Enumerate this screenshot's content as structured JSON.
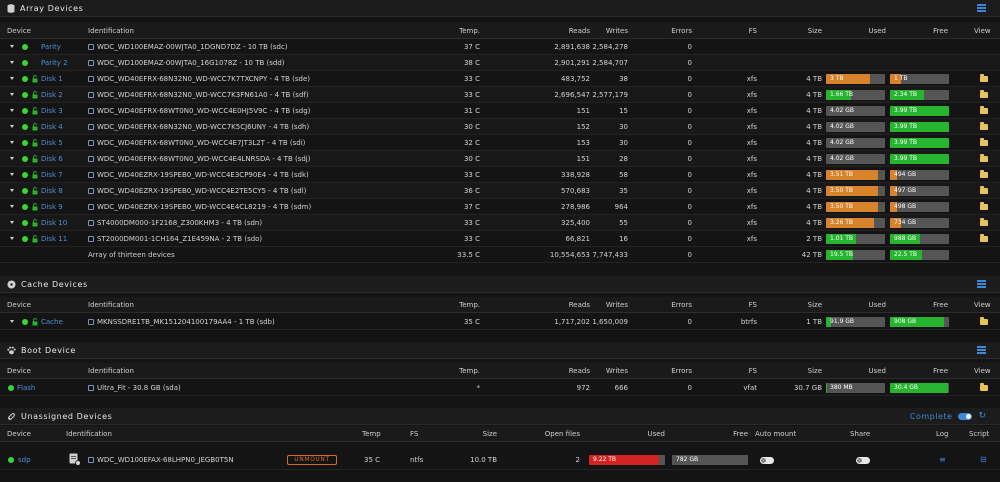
{
  "array": {
    "title": "Array Devices",
    "headers": {
      "device": "Device",
      "identification": "Identification",
      "temp": "Temp.",
      "reads": "Reads",
      "writes": "Writes",
      "errors": "Errors",
      "fs": "FS",
      "size": "Size",
      "used": "Used",
      "free": "Free",
      "view": "View"
    },
    "rows": [
      {
        "name": "Parity",
        "lock": false,
        "id": "WDC_WD100EMAZ-00WJTA0_1DGND7DZ - 10 TB (sdc)",
        "temp": "37 C",
        "reads": "2,891,638",
        "writes": "2,584,278",
        "errors": "0",
        "fs": "",
        "size": "",
        "used": null,
        "free": null,
        "view": false
      },
      {
        "name": "Parity 2",
        "lock": false,
        "id": "WDC_WD100EMAZ-00WJTA0_16G1078Z - 10 TB (sdd)",
        "temp": "38 C",
        "reads": "2,901,291",
        "writes": "2,584,707",
        "errors": "0",
        "fs": "",
        "size": "",
        "used": null,
        "free": null,
        "view": false
      },
      {
        "name": "Disk 1",
        "lock": true,
        "id": "WDC_WD40EFRX-68N32N0_WD-WCC7K7TXCNPY - 4 TB (sde)",
        "temp": "33 C",
        "reads": "483,752",
        "writes": "38",
        "errors": "0",
        "fs": "xfs",
        "size": "4 TB",
        "used": {
          "label": "3 TB",
          "pct": 75,
          "color": "orange"
        },
        "free": {
          "label": "1 TB",
          "pct": 18,
          "color": "orange"
        },
        "view": true
      },
      {
        "name": "Disk 2",
        "lock": true,
        "id": "WDC_WD40EFRX-68N32N0_WD-WCC7K3FN61A0 - 4 TB (sdf)",
        "temp": "33 C",
        "reads": "2,696,547",
        "writes": "2,577,179",
        "errors": "0",
        "fs": "xfs",
        "size": "4 TB",
        "used": {
          "label": "1.66 TB",
          "pct": 42,
          "color": "green"
        },
        "free": {
          "label": "2.34 TB",
          "pct": 58,
          "color": "green"
        },
        "view": true
      },
      {
        "name": "Disk 3",
        "lock": true,
        "id": "WDC_WD40EFRX-68WT0N0_WD-WCC4E0HJ5V9C - 4 TB (sdg)",
        "temp": "31 C",
        "reads": "151",
        "writes": "15",
        "errors": "0",
        "fs": "xfs",
        "size": "4 TB",
        "used": {
          "label": "4.02 GB",
          "pct": 0,
          "color": "green"
        },
        "free": {
          "label": "3.99 TB",
          "pct": 100,
          "color": "green"
        },
        "view": true
      },
      {
        "name": "Disk 4",
        "lock": true,
        "id": "WDC_WD40EFRX-68N32N0_WD-WCC7K5CJ6UNY - 4 TB (sdh)",
        "temp": "30 C",
        "reads": "152",
        "writes": "30",
        "errors": "0",
        "fs": "xfs",
        "size": "4 TB",
        "used": {
          "label": "4.02 GB",
          "pct": 0,
          "color": "green"
        },
        "free": {
          "label": "3.99 TB",
          "pct": 100,
          "color": "green"
        },
        "view": true
      },
      {
        "name": "Disk 5",
        "lock": true,
        "id": "WDC_WD40EFRX-68WT0N0_WD-WCC4E7JT3L2T - 4 TB (sdi)",
        "temp": "32 C",
        "reads": "153",
        "writes": "30",
        "errors": "0",
        "fs": "xfs",
        "size": "4 TB",
        "used": {
          "label": "4.02 GB",
          "pct": 0,
          "color": "green"
        },
        "free": {
          "label": "3.99 TB",
          "pct": 100,
          "color": "green"
        },
        "view": true
      },
      {
        "name": "Disk 6",
        "lock": true,
        "id": "WDC_WD40EFRX-68WT0N0_WD-WCC4E4LNRSDA - 4 TB (sdj)",
        "temp": "30 C",
        "reads": "151",
        "writes": "28",
        "errors": "0",
        "fs": "xfs",
        "size": "4 TB",
        "used": {
          "label": "4.02 GB",
          "pct": 0,
          "color": "green"
        },
        "free": {
          "label": "3.99 TB",
          "pct": 100,
          "color": "green"
        },
        "view": true
      },
      {
        "name": "Disk 7",
        "lock": true,
        "id": "WDC_WD40EZRX-19SPEB0_WD-WCC4E3CP90E4 - 4 TB (sdk)",
        "temp": "33 C",
        "reads": "338,928",
        "writes": "58",
        "errors": "0",
        "fs": "xfs",
        "size": "4 TB",
        "used": {
          "label": "3.51 TB",
          "pct": 88,
          "color": "orange"
        },
        "free": {
          "label": "494 GB",
          "pct": 12,
          "color": "orange"
        },
        "view": true
      },
      {
        "name": "Disk 8",
        "lock": true,
        "id": "WDC_WD40EZRX-19SPEB0_WD-WCC4E2TE5CY5 - 4 TB (sdl)",
        "temp": "36 C",
        "reads": "570,683",
        "writes": "35",
        "errors": "0",
        "fs": "xfs",
        "size": "4 TB",
        "used": {
          "label": "3.50 TB",
          "pct": 88,
          "color": "orange"
        },
        "free": {
          "label": "497 GB",
          "pct": 12,
          "color": "orange"
        },
        "view": true
      },
      {
        "name": "Disk 9",
        "lock": true,
        "id": "WDC_WD40EZRX-19SPEB0_WD-WCC4E4CL8219 - 4 TB (sdm)",
        "temp": "37 C",
        "reads": "278,986",
        "writes": "964",
        "errors": "0",
        "fs": "xfs",
        "size": "4 TB",
        "used": {
          "label": "3.50 TB",
          "pct": 88,
          "color": "orange"
        },
        "free": {
          "label": "498 GB",
          "pct": 12,
          "color": "orange"
        },
        "view": true
      },
      {
        "name": "Disk 10",
        "lock": true,
        "id": "ST4000DM000-1F2168_Z300KHM3 - 4 TB (sdn)",
        "temp": "33 C",
        "reads": "325,400",
        "writes": "55",
        "errors": "0",
        "fs": "xfs",
        "size": "4 TB",
        "used": {
          "label": "3.26 TB",
          "pct": 82,
          "color": "orange"
        },
        "free": {
          "label": "734 GB",
          "pct": 18,
          "color": "orange"
        },
        "view": true
      },
      {
        "name": "Disk 11",
        "lock": true,
        "id": "ST2000DM001-1CH164_Z1E459NA - 2 TB (sdo)",
        "temp": "33 C",
        "reads": "66,821",
        "writes": "16",
        "errors": "0",
        "fs": "xfs",
        "size": "2 TB",
        "used": {
          "label": "1.01 TB",
          "pct": 50,
          "color": "green"
        },
        "free": {
          "label": "988 GB",
          "pct": 50,
          "color": "green"
        },
        "view": true
      }
    ],
    "summary": {
      "label": "Array of thirteen devices",
      "temp": "33.5 C",
      "reads": "10,554,653",
      "writes": "7,747,433",
      "errors": "0",
      "size": "42 TB",
      "used": {
        "label": "19.5 TB",
        "pct": 46,
        "color": "green"
      },
      "free": {
        "label": "22.5 TB",
        "pct": 54,
        "color": "green"
      }
    }
  },
  "cache": {
    "title": "Cache Devices",
    "headers": {
      "device": "Device",
      "identification": "Identification",
      "temp": "Temp.",
      "reads": "Reads",
      "writes": "Writes",
      "errors": "Errors",
      "fs": "FS",
      "size": "Size",
      "used": "Used",
      "free": "Free",
      "view": "View"
    },
    "rows": [
      {
        "name": "Cache",
        "lock": true,
        "id": "MKNSSDRE1TB_MK151204100179AA4 - 1 TB (sdb)",
        "temp": "35 C",
        "reads": "1,717,202",
        "writes": "1,650,009",
        "errors": "0",
        "fs": "btrfs",
        "size": "1 TB",
        "used": {
          "label": "91.9 GB",
          "pct": 9,
          "color": "green"
        },
        "free": {
          "label": "908 GB",
          "pct": 91,
          "color": "green"
        },
        "view": true
      }
    ]
  },
  "boot": {
    "title": "Boot Device",
    "headers": {
      "device": "Device",
      "identification": "Identification",
      "temp": "Temp.",
      "reads": "Reads",
      "writes": "Writes",
      "errors": "Errors",
      "fs": "FS",
      "size": "Size",
      "used": "Used",
      "free": "Free",
      "view": "View"
    },
    "rows": [
      {
        "name": "Flash",
        "id": "Ultra_Fit - 30.8 GB (sda)",
        "temp": "*",
        "reads": "972",
        "writes": "666",
        "errors": "0",
        "fs": "vfat",
        "size": "30.7 GB",
        "used": {
          "label": "380 MB",
          "pct": 1,
          "color": "green"
        },
        "free": {
          "label": "30.4 GB",
          "pct": 99,
          "color": "green"
        },
        "view": true
      }
    ]
  },
  "unassigned": {
    "title": "Unassigned Devices",
    "status": "Complete",
    "headers": {
      "device": "Device",
      "identification": "Identification",
      "temp": "Temp",
      "fs": "FS",
      "size": "Size",
      "open_files": "Open files",
      "used": "Used",
      "free": "Free",
      "auto_mount": "Auto mount",
      "share": "Share",
      "log": "Log",
      "script": "Script"
    },
    "row": {
      "name": "sdp",
      "id": "WDC_WD100EFAX-68LHPN0_JEGB0T5N",
      "button": "UNMOUNT",
      "temp": "35 C",
      "fs": "ntfs",
      "size": "10.0 TB",
      "open_files": "2",
      "used": {
        "label": "9.22 TB",
        "pct": 92,
        "color": "red"
      },
      "free": {
        "label": "782 GB",
        "pct": 8,
        "color": "gray"
      }
    }
  },
  "colors": {
    "accent": "#3b87d9",
    "online": "#3ad33a",
    "used_orange": "#d8822b",
    "used_green": "#27b42e",
    "unmount": "#d46a2a"
  }
}
